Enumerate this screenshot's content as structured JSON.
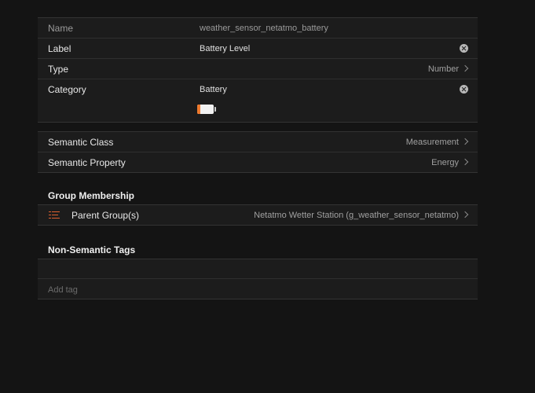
{
  "details": {
    "name_label": "Name",
    "name_value": "weather_sensor_netatmo_battery",
    "label_label": "Label",
    "label_value": "Battery Level",
    "type_label": "Type",
    "type_value": "Number",
    "category_label": "Category",
    "category_value": "Battery",
    "battery_level_fraction": 0.2,
    "battery_color": "#ef7a2e"
  },
  "semantics": {
    "class_label": "Semantic Class",
    "class_value": "Measurement",
    "property_label": "Semantic Property",
    "property_value": "Energy"
  },
  "group_membership": {
    "title": "Group Membership",
    "parent_label": "Parent Group(s)",
    "parent_value": "Netatmo Wetter Station (g_weather_sensor_netatmo)",
    "icon": "list-icon"
  },
  "tags": {
    "title": "Non-Semantic Tags",
    "add_placeholder": "Add tag"
  }
}
